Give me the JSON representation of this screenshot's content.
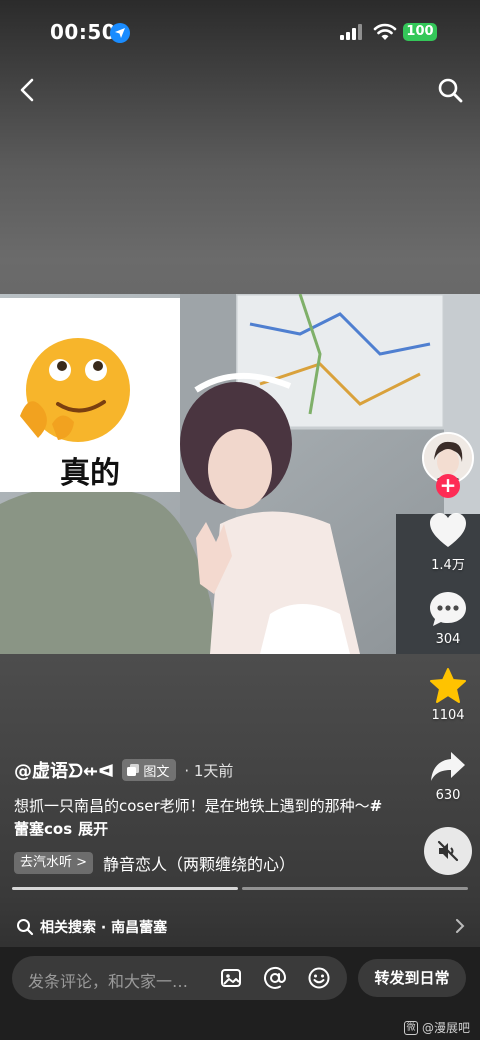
{
  "status_bar": {
    "time": "00:50",
    "battery": "100"
  },
  "sticker": {
    "text": "真的"
  },
  "rail": {
    "likes": "1.4万",
    "comments": "304",
    "favorites": "1104",
    "shares": "630"
  },
  "post": {
    "author": "@虚语ᗤ⇷ᐊ",
    "tag": "图文",
    "time_ago": "· 1天前",
    "caption": "想抓一只南昌的coser老师！是在地铁上遇到的那种～",
    "hashtag": "#蕾塞cos",
    "expand": "展开",
    "music_source": "去汽水听 >",
    "music_title": "静音恋人（两颗缠绕的心）"
  },
  "related_search": {
    "label": "相关搜索 · 南昌蕾塞"
  },
  "bottom_bar": {
    "comment_placeholder": "发条评论，和大家一…",
    "share_daily": "转发到日常",
    "watermark": "@漫展吧"
  },
  "colors": {
    "accent_red": "#fe2c55",
    "favorite_yellow": "#ffc300",
    "location_blue": "#1a8cff",
    "battery_green": "#34c759"
  },
  "icons": [
    "back-icon",
    "search-icon",
    "heart-icon",
    "comment-icon",
    "star-icon",
    "share-arrow-icon",
    "mute-icon",
    "image-icon",
    "at-icon",
    "emoji-icon"
  ]
}
